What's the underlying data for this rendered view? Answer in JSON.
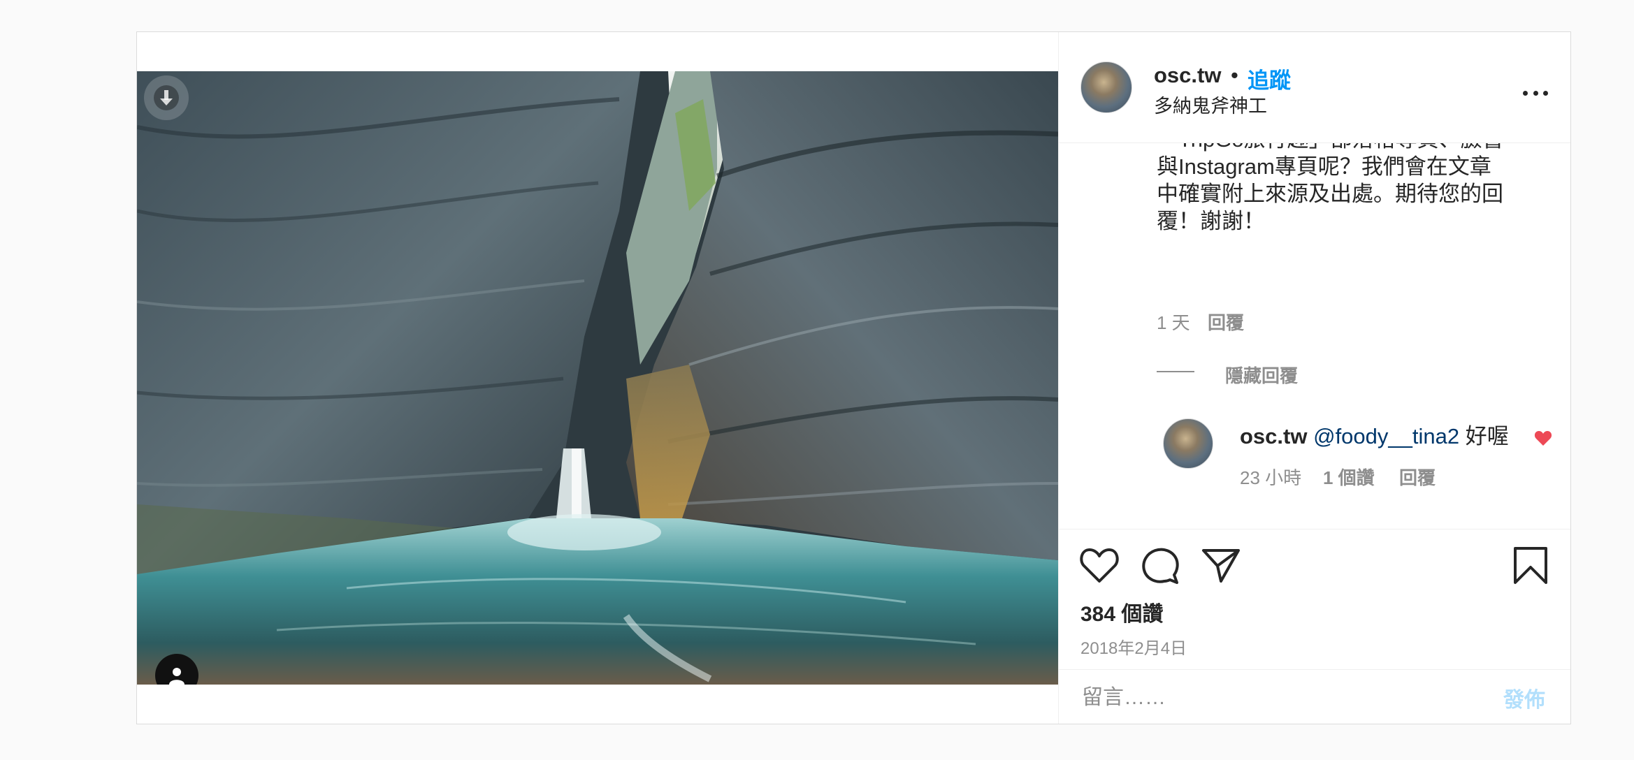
{
  "header": {
    "username": "osc.tw",
    "separator": "•",
    "follow_label": "追蹤",
    "location": "多納鬼斧神工",
    "more_icon": "more-horizontal-icon"
  },
  "comments": {
    "partial_lines": [
      "",
      "「TripGo旅行趣」部落格專頁、臉書",
      "與Instagram專頁呢？我們會在文章",
      "中確實附上來源及出處。期待您的回",
      "覆！謝謝！"
    ],
    "partial_meta": {
      "time": "1 天",
      "reply": "回覆"
    },
    "hide_replies": "隱藏回覆",
    "reply": {
      "username": "osc.tw",
      "mention": "@foody__tina2",
      "text": "好喔",
      "time": "23 小時",
      "likes": "1 個讚",
      "reply_label": "回覆"
    }
  },
  "actions": {
    "icons": [
      "heart-icon",
      "comment-icon",
      "share-icon",
      "bookmark-icon"
    ],
    "likes": "384 個讚",
    "date": "2018年2月4日"
  },
  "compose": {
    "placeholder": "留言……",
    "post_label": "發佈"
  },
  "colors": {
    "accent": "#0095f6",
    "liked": "#ed4956",
    "muted": "#8e8e8e",
    "mention": "#00376b",
    "post_disabled": "#b2dffc"
  }
}
